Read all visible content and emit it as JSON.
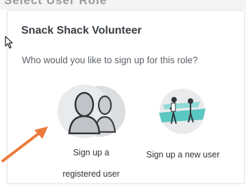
{
  "header": {
    "partial_heading": "Select User Role"
  },
  "dialog": {
    "title": "Snack Shack Volunteer",
    "question": "Who would you like to sign up for this role?"
  },
  "options": {
    "registered": {
      "label_line1": "Sign up a",
      "label_line2": "registered user",
      "icon": "registered-users-icon"
    },
    "new_user": {
      "label": "Sign up a new user",
      "icon": "new-user-illustration-icon"
    }
  },
  "colors": {
    "annotation_arrow": "#ec7a3c",
    "illustration_teal": "#5bc7c2",
    "avatar_gray": "#bfc2c6",
    "circle_background": "#e9eaeb"
  }
}
